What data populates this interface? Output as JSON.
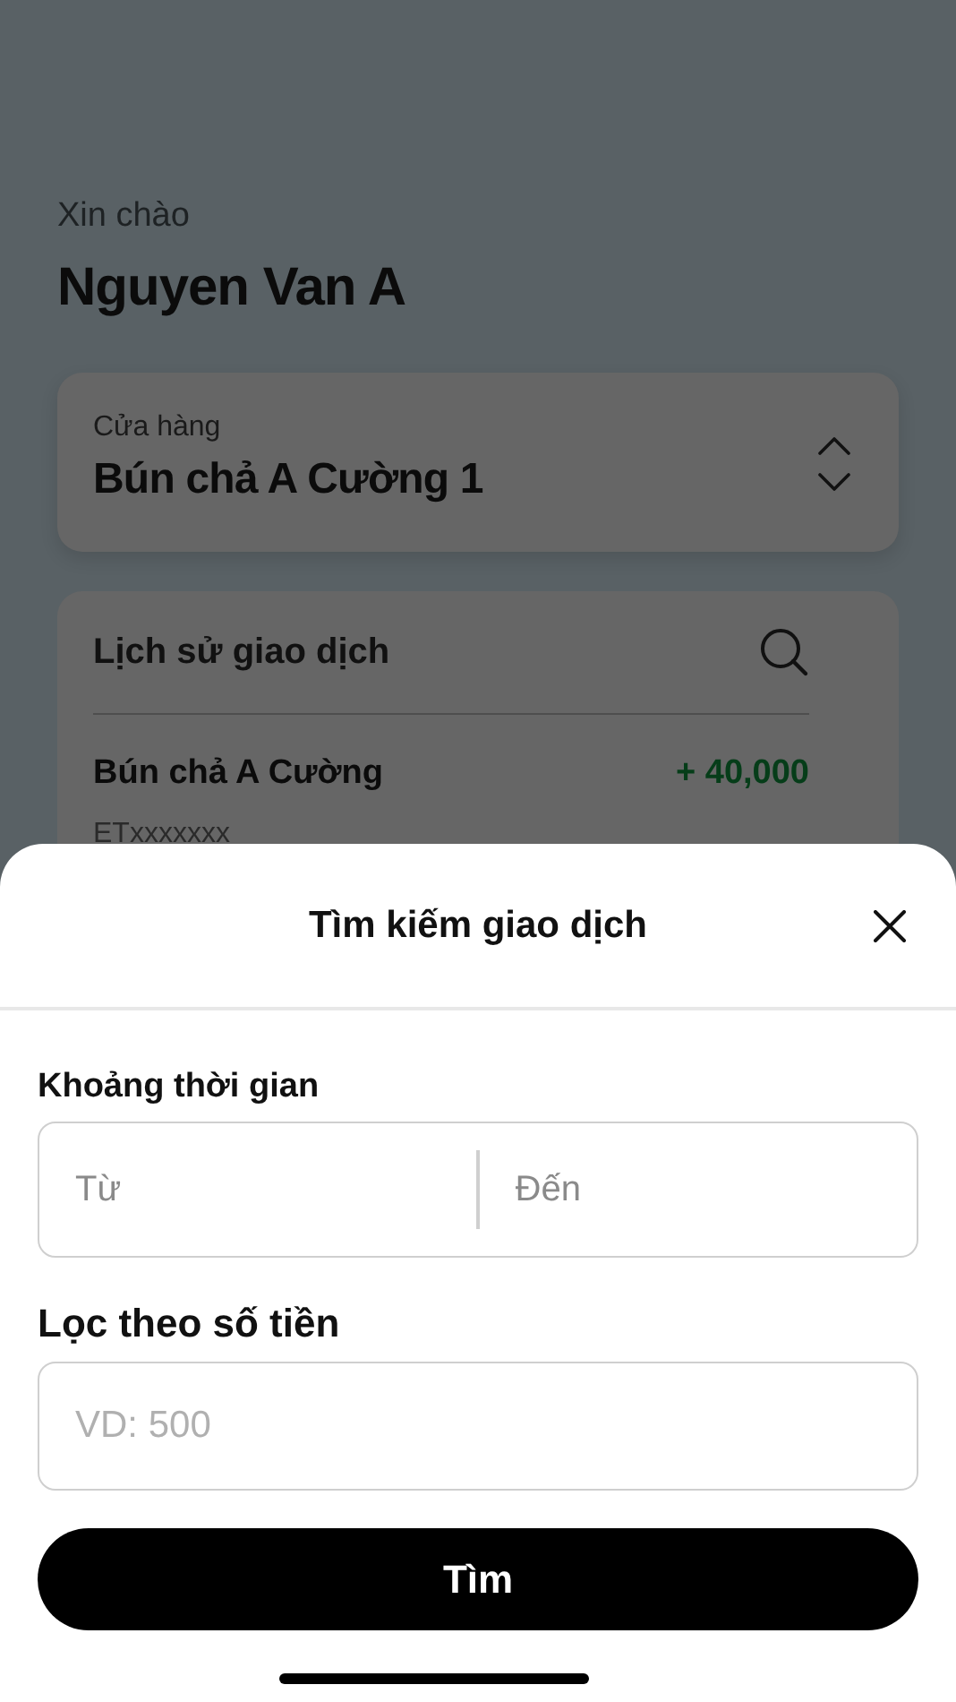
{
  "greeting": "Xin chào",
  "user_name": "Nguyen Van A",
  "store_picker": {
    "label": "Cửa hàng",
    "value": "Bún chả A Cường 1"
  },
  "history": {
    "title": "Lịch sử giao dịch",
    "transactions": [
      {
        "name": "Bún chả A Cường",
        "amount": "+ 40,000",
        "code": "ETxxxxxxx",
        "kind": "income"
      }
    ]
  },
  "search_sheet": {
    "title": "Tìm kiếm giao dịch",
    "time_range": {
      "label": "Khoảng thời gian",
      "from_placeholder": "Từ",
      "to_placeholder": "Đến"
    },
    "amount_filter": {
      "label": "Lọc theo số tiền",
      "placeholder": "VD: 500"
    },
    "submit": "Tìm"
  }
}
